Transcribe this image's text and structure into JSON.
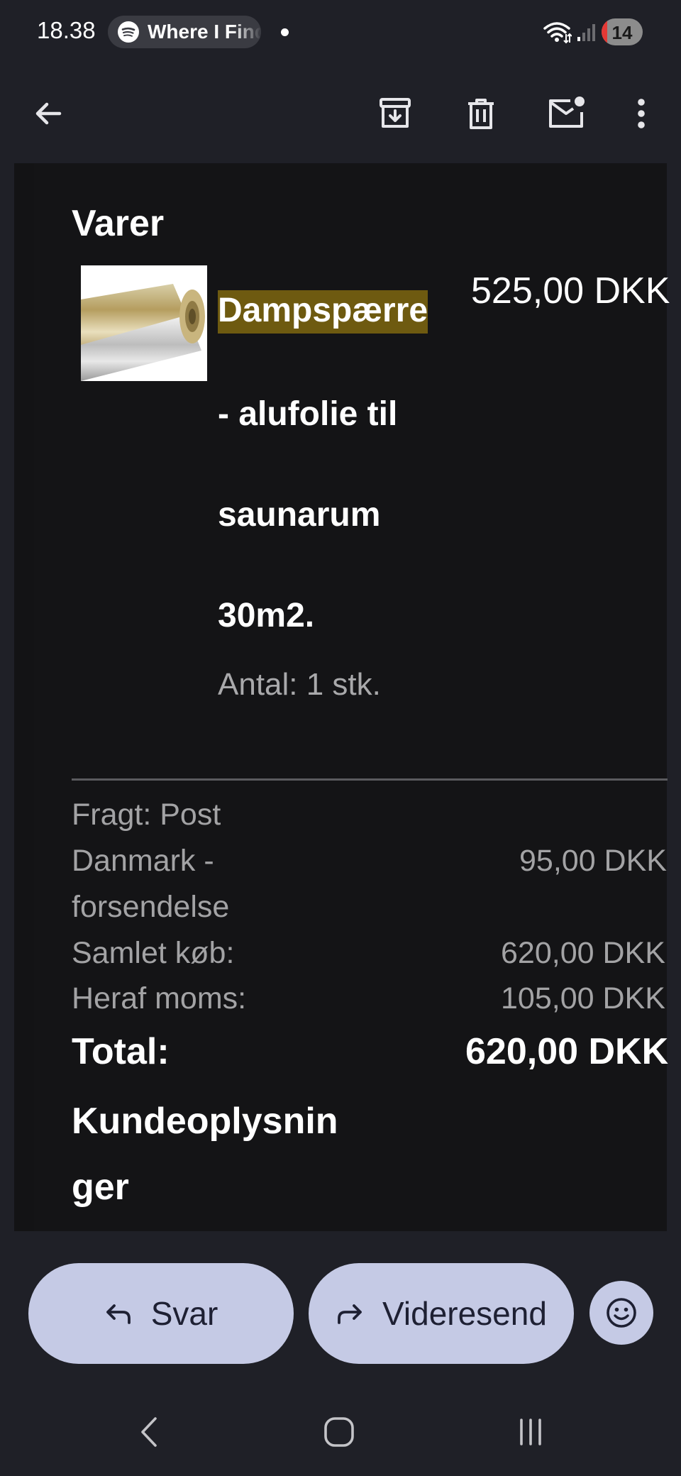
{
  "status_bar": {
    "time": "18.38",
    "media_text": "Where I Find",
    "battery_level": "14"
  },
  "app_bar": {
    "icons": [
      "back-arrow-icon",
      "archive-icon",
      "delete-icon",
      "mark-unread-icon",
      "more-vert-icon"
    ]
  },
  "email": {
    "items_heading": "Varer",
    "product": {
      "name_lines": [
        "Dampspærre",
        "- alufolie til",
        "saunarum",
        "30m2."
      ],
      "price": "525,00 DKK",
      "quantity": "Antal: 1 stk."
    },
    "summary": {
      "shipping_label_lines": [
        "Fragt: Post",
        "Danmark -",
        "forsendelse"
      ],
      "shipping_value": "95,00 DKK",
      "subtotal_label": "Samlet køb:",
      "subtotal_value": "620,00 DKK",
      "vat_label": "Heraf moms:",
      "vat_value": "105,00 DKK",
      "total_label": "Total:",
      "total_value": "620,00 DKK"
    },
    "customer_heading_lines": [
      "Kundeoplysnin",
      "ger"
    ],
    "highlight_color": "#6e5a10"
  },
  "actions": {
    "reply_label": "Svar",
    "forward_label": "Videresend",
    "button_color": "#c5cae5"
  },
  "system_nav": {
    "icons": [
      "back-nav-icon",
      "home-nav-icon",
      "recents-nav-icon"
    ]
  }
}
